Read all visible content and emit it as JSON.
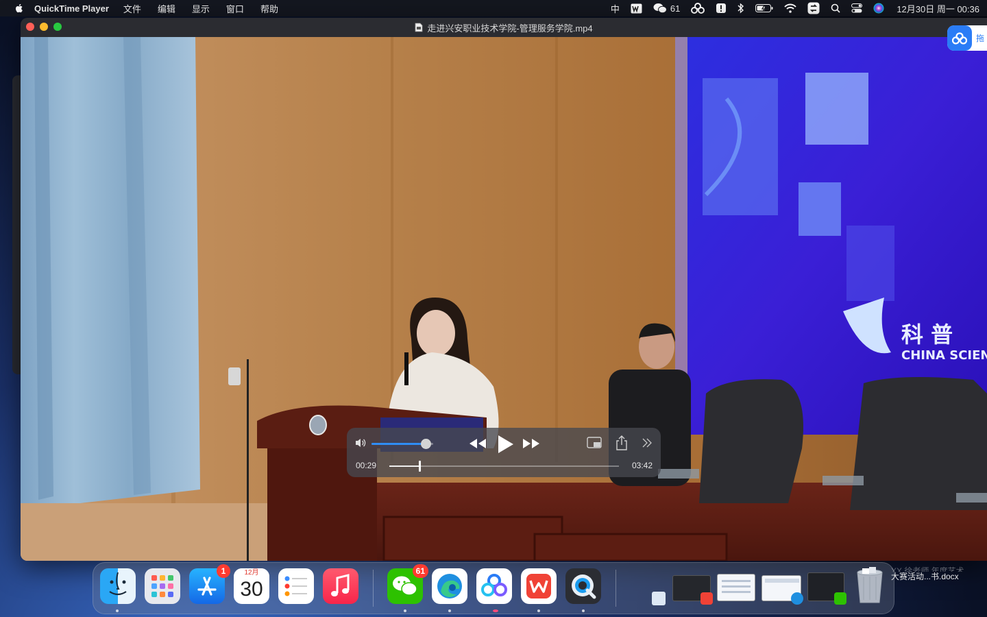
{
  "menubar": {
    "app_name": "QuickTime Player",
    "menus": [
      "文件",
      "编辑",
      "显示",
      "窗口",
      "帮助"
    ],
    "status": {
      "input_method": "中",
      "wechat_count": "61",
      "datetime": "12月30日 周一  00:36"
    }
  },
  "window": {
    "title": "走进兴安职业技术学院-管理服务学院.mp4"
  },
  "video": {
    "screen_text_1": "科 普",
    "screen_text_2": "CHINA SCIENCE"
  },
  "player": {
    "current_time": "00:29",
    "total_time": "03:42",
    "progress_fraction": 0.131,
    "volume_fraction": 0.88
  },
  "baidu_widget": {
    "label": "拖"
  },
  "dock": {
    "apps": [
      {
        "name": "Finder",
        "icon": "finder-icon",
        "running": true
      },
      {
        "name": "Launchpad",
        "icon": "launchpad-icon",
        "running": false
      },
      {
        "name": "App Store",
        "icon": "app-store-icon",
        "running": false,
        "badge": "1"
      },
      {
        "name": "Calendar",
        "icon": "calendar-icon",
        "running": false,
        "month": "12月",
        "day": "30"
      },
      {
        "name": "Reminders",
        "icon": "reminders-icon",
        "running": false
      },
      {
        "name": "Music",
        "icon": "music-icon",
        "running": false
      },
      {
        "name": "WeChat",
        "icon": "wechat-icon",
        "running": true,
        "badge": "61"
      },
      {
        "name": "Edge",
        "icon": "edge-icon",
        "running": true
      },
      {
        "name": "Baidu Netdisk",
        "icon": "baidu-netdisk-icon",
        "running": true
      },
      {
        "name": "WPS Office",
        "icon": "wps-icon",
        "running": true
      },
      {
        "name": "QuickTime Player",
        "icon": "quicktime-icon",
        "running": true
      }
    ],
    "recent_doc_label": "大赛活动...书.docx",
    "recent_doc_label_faint": "XX 徐老师 年度艺术"
  },
  "colors": {
    "accent_blue": "#2f8df5",
    "badge_red": "#ff3b30",
    "stage_blue": "#3a1fd6"
  }
}
